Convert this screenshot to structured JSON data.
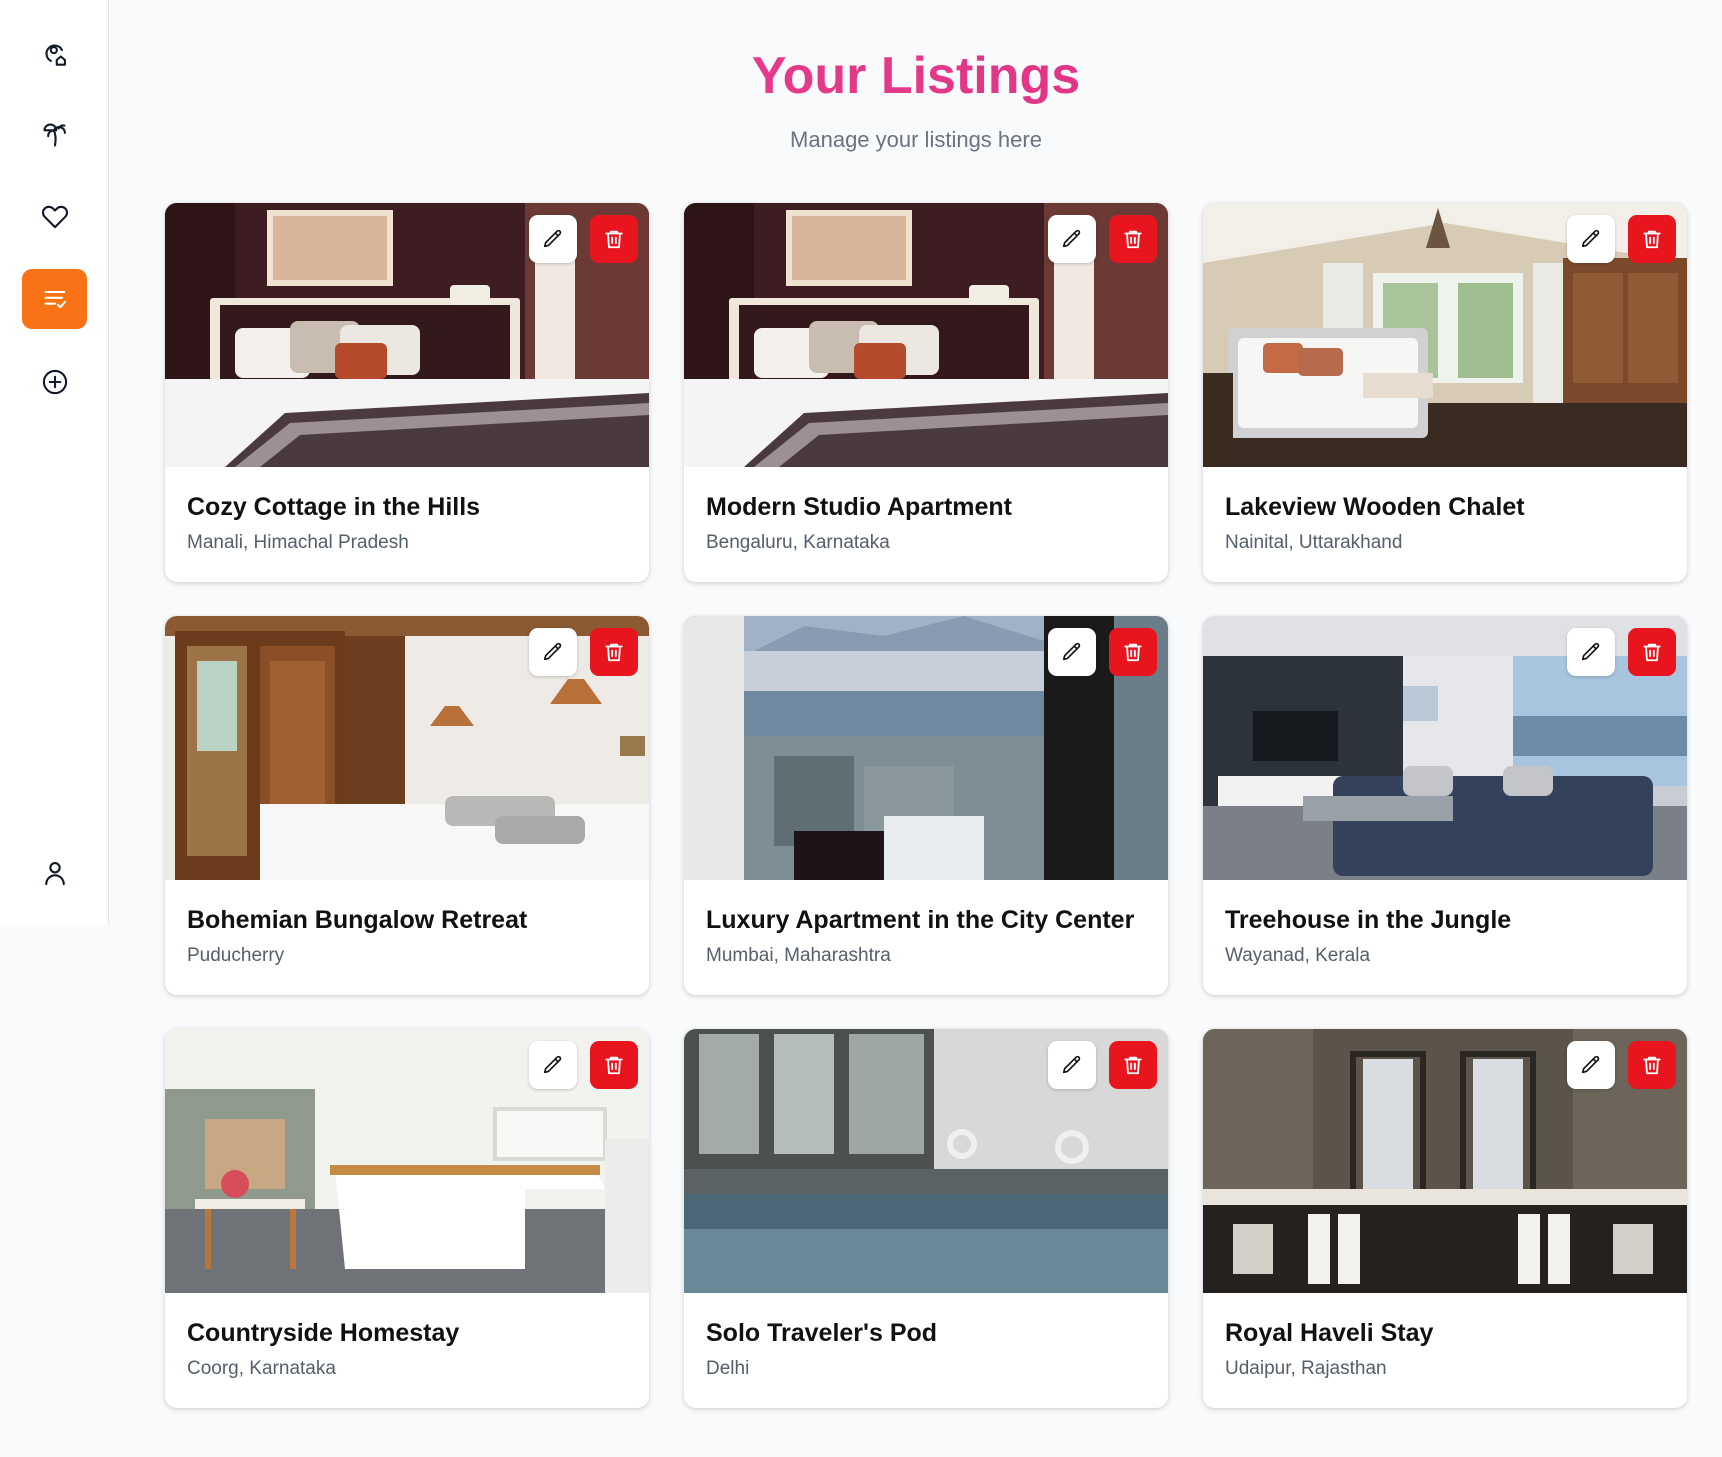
{
  "sidebar": {
    "items": [
      {
        "icon": "map-pin-home-icon",
        "active": false
      },
      {
        "icon": "palm-tree-icon",
        "active": false
      },
      {
        "icon": "heart-icon",
        "active": false
      },
      {
        "icon": "list-check-icon",
        "active": true
      },
      {
        "icon": "plus-circle-icon",
        "active": false
      },
      {
        "icon": "user-icon",
        "active": false
      }
    ]
  },
  "colors": {
    "accent": "#f97316",
    "title_gradient_start": "#ec4899",
    "title_gradient_end": "#db2777",
    "delete": "#e8141e"
  },
  "header": {
    "title": "Your Listings",
    "subtitle": "Manage your listings here"
  },
  "listings": [
    {
      "title": "Cozy Cottage in the Hills",
      "location": "Manali, Himachal Pradesh",
      "photo": "hotel-bedroom"
    },
    {
      "title": "Modern Studio Apartment",
      "location": "Bengaluru, Karnataka",
      "photo": "hotel-bedroom"
    },
    {
      "title": "Lakeview Wooden Chalet",
      "location": "Nainital, Uttarakhand",
      "photo": "chalet-bedroom"
    },
    {
      "title": "Bohemian Bungalow Retreat",
      "location": "Puducherry",
      "photo": "bungalow-bedroom"
    },
    {
      "title": "Luxury Apartment in the City Center",
      "location": "Mumbai, Maharashtra",
      "photo": "city-harbor-view"
    },
    {
      "title": "Treehouse in the Jungle",
      "location": "Wayanad, Kerala",
      "photo": "living-room-sea-view"
    },
    {
      "title": "Countryside Homestay",
      "location": "Coorg, Karnataka",
      "photo": "white-kitchen"
    },
    {
      "title": "Solo Traveler's Pod",
      "location": "Delhi",
      "photo": "indoor-pool"
    },
    {
      "title": "Royal Haveli Stay",
      "location": "Udaipur, Rajasthan",
      "photo": "bathroom-vanity"
    }
  ]
}
